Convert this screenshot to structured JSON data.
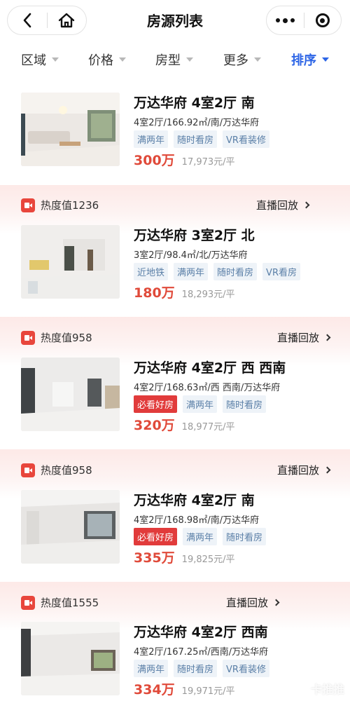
{
  "header": {
    "title": "房源列表",
    "back_icon": "chevron-left-icon",
    "home_icon": "home-icon",
    "more_icon": "more-dots-icon",
    "close_icon": "target-circle-icon"
  },
  "filters": [
    {
      "label": "区域",
      "active": false
    },
    {
      "label": "价格",
      "active": false
    },
    {
      "label": "房型",
      "active": false
    },
    {
      "label": "更多",
      "active": false
    },
    {
      "label": "排序",
      "active": true
    }
  ],
  "colors": {
    "accent_blue": "#2d65e6",
    "price_red": "#e04a3a",
    "hot_tag_red": "#e13b3b",
    "tag_text": "#5a7fa7",
    "tag_bg": "#eef3f8"
  },
  "listings": [
    {
      "title": "万达华府 4室2厅 南",
      "subtitle": "4室2厅/166.92㎡/南/万达华府",
      "tags": [
        "满两年",
        "随时看房",
        "VR看装修"
      ],
      "price": "300万",
      "unit_price": "17,973元/平"
    },
    {
      "heat": "热度值1236",
      "live": "直播回放",
      "title": "万达华府 3室2厅 北",
      "subtitle": "3室2厅/98.4㎡/北/万达华府",
      "tags": [
        "近地铁",
        "满两年",
        "随时看房",
        "VR看房"
      ],
      "price": "180万",
      "unit_price": "18,293元/平"
    },
    {
      "heat": "热度值958",
      "live": "直播回放",
      "title": "万达华府 4室2厅 西 西南",
      "subtitle": "4室2厅/168.63㎡/西 西南/万达华府",
      "hot_tag": "必看好房",
      "tags": [
        "满两年",
        "随时看房"
      ],
      "price": "320万",
      "unit_price": "18,977元/平"
    },
    {
      "heat": "热度值958",
      "live": "直播回放",
      "title": "万达华府 4室2厅 南",
      "subtitle": "4室2厅/168.98㎡/南/万达华府",
      "hot_tag": "必看好房",
      "tags": [
        "满两年",
        "随时看房"
      ],
      "price": "335万",
      "unit_price": "19,825元/平"
    },
    {
      "heat": "热度值1555",
      "live": "直播回放",
      "title": "万达华府 4室2厅 西南",
      "subtitle": "4室2厅/167.25㎡/西南/万达华府",
      "tags": [
        "满两年",
        "随时看房",
        "VR看装修"
      ],
      "price": "334万",
      "unit_price": "19,971元/平"
    }
  ],
  "watermark": "卡推推"
}
